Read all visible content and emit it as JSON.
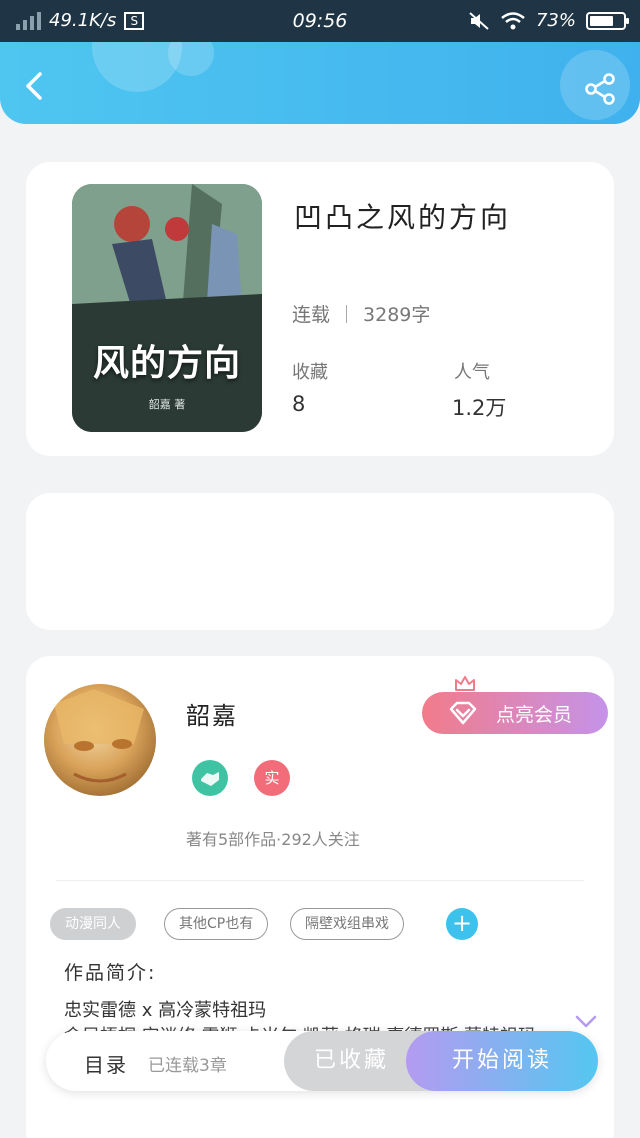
{
  "status_bar": {
    "net_speed": "49.1K/s",
    "time": "09:56",
    "battery": "73%",
    "battery_level": 0.73
  },
  "book": {
    "title": "凹凸之风的方向",
    "cover_title": "风的方向",
    "cover_author": "韶嘉 著",
    "status": "连载",
    "word_count": "3289字",
    "favorites_label": "收藏",
    "favorites_value": "8",
    "popularity_label": "人气",
    "popularity_value": "1.2万"
  },
  "author": {
    "name": "韶嘉",
    "real_badge": "实",
    "vip_label": "点亮会员",
    "works_text": "著有5部作品·292人关注"
  },
  "tags": [
    "动漫同人",
    "其他CP也有",
    "隔壁戏组串戏"
  ],
  "intro": {
    "heading": "作品简介:",
    "line1": "忠实雷德 x 高冷蒙特祖玛",
    "line2": "金凤梧桐 安迷修 雷狮 卡米尔 凯莉 格瑞 嘉德罗斯 蒙特祖玛"
  },
  "bottom": {
    "toc_label": "目录",
    "toc_status": "已连载3章",
    "collected_label": "已收藏",
    "read_label": "开始阅读"
  },
  "colors": {
    "accent": "#3fb1ee",
    "vip_start": "#f27b8a",
    "vip_end": "#c593e9",
    "read_start": "#b49bf0",
    "read_end": "#54c7f1"
  }
}
